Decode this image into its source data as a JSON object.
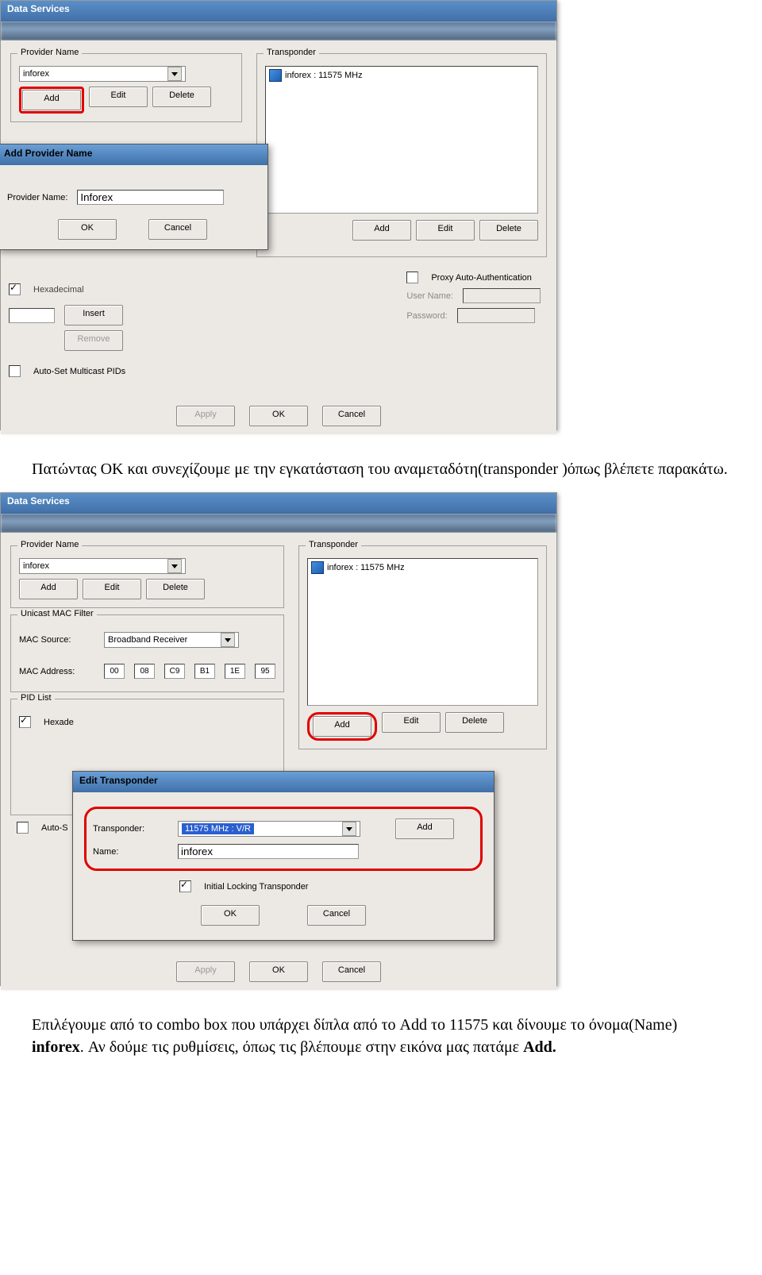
{
  "screenshot1": {
    "windowTitle": "Data Services",
    "providerGroup": "Provider Name",
    "transponderGroup": "Transponder",
    "providerValue": "inforex",
    "transponderItem": "inforex : 11575 MHz",
    "btn_add": "Add",
    "btn_edit": "Edit",
    "btn_delete": "Delete",
    "dialog": {
      "title": "Add Provider Name",
      "label": "Provider Name:",
      "value": "Inforex",
      "ok": "OK",
      "cancel": "Cancel"
    },
    "hexadecimal": "Hexadecimal",
    "insert": "Insert",
    "remove": "Remove",
    "autoSet": "Auto-Set Multicast PIDs",
    "proxyAuth": "Proxy Auto-Authentication",
    "userName": "User Name:",
    "password": "Password:",
    "apply": "Apply",
    "ok": "OK",
    "cancel": "Cancel"
  },
  "para1": {
    "text1": "Πατώντας ΟΚ και συνεχίζουμε με την εγκατάσταση του αναμεταδότη(transponder )όπως βλέπετε παρακάτω."
  },
  "screenshot2": {
    "windowTitle": "Data Services",
    "providerGroup": "Provider Name",
    "transponderGroup": "Transponder",
    "providerValue": "inforex",
    "transponderItem": "inforex : 11575 MHz",
    "btn_add": "Add",
    "btn_edit": "Edit",
    "btn_delete": "Delete",
    "unicastGroup": "Unicast MAC Filter",
    "macSourceLabel": "MAC Source:",
    "macSourceValue": "Broadband Receiver",
    "macAddressLabel": "MAC Address:",
    "mac": [
      "00",
      "08",
      "C9",
      "B1",
      "1E",
      "95"
    ],
    "pidListGroup": "PID List",
    "hexLabel": "Hexade",
    "autoS": "Auto-S",
    "dialog": {
      "title": "Edit Transponder",
      "transponderLabel": "Transponder:",
      "transponderValue": "11575 MHz  :  V/R",
      "nameLabel": "Name:",
      "nameValue": "inforex",
      "addBtn": "Add",
      "initialLocking": "Initial Locking Transponder",
      "ok": "OK",
      "cancel": "Cancel"
    },
    "apply": "Apply",
    "ok": "OK",
    "cancel": "Cancel"
  },
  "para2": {
    "pre": "Επιλέγουμε από το combo box που υπάρχει δίπλα από το Add το  11575 και δίνουμε το όνομα(Name) ",
    "bold1": "inforex",
    "mid": ". Αν δούμε τις ρυθμίσεις, όπως τις βλέπουμε στην εικόνα μας πατάμε ",
    "bold2": "Add."
  }
}
